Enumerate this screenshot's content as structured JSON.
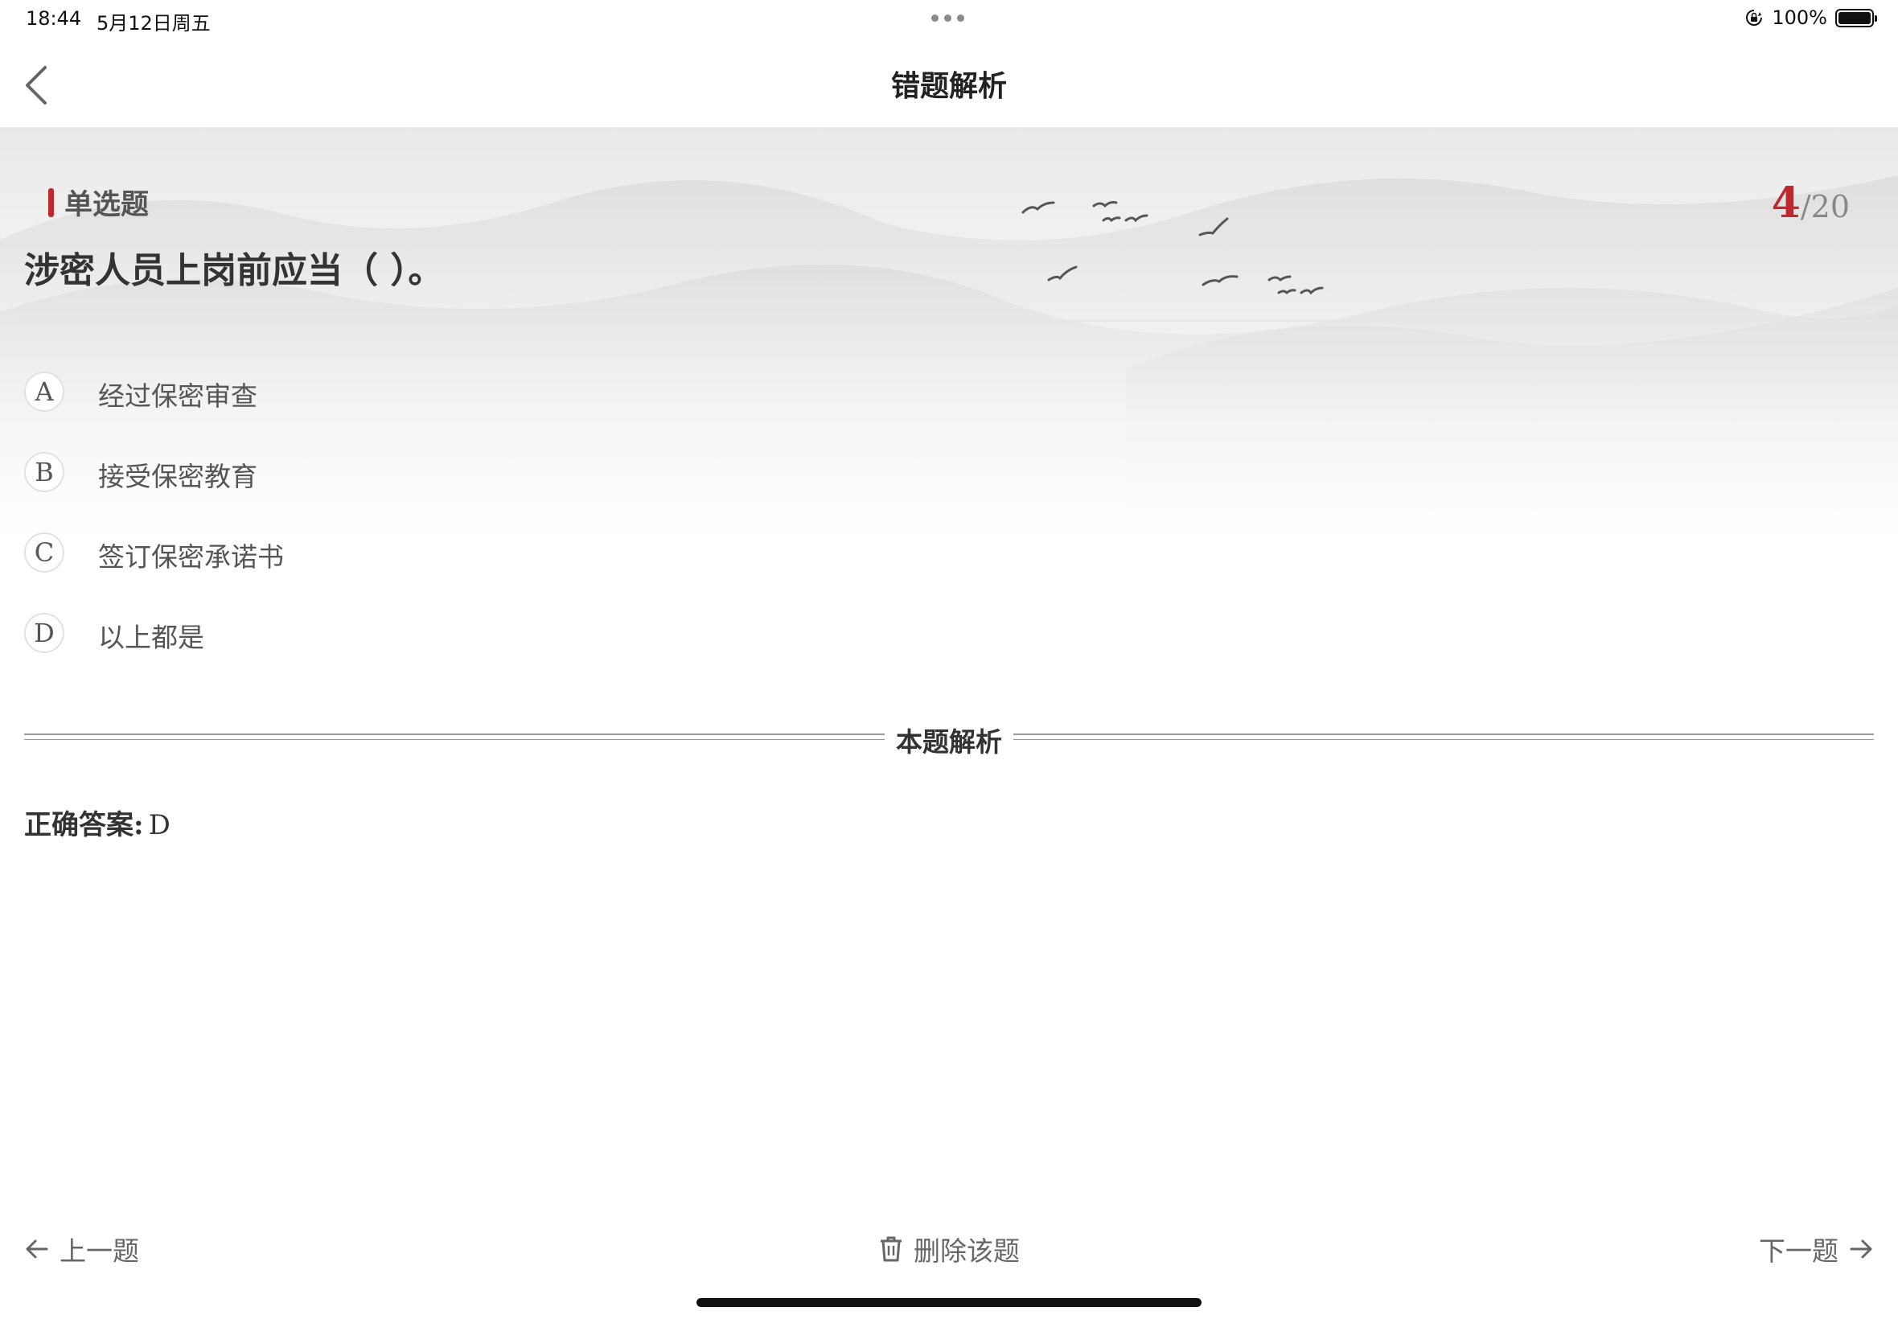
{
  "status_bar": {
    "time": "18:44",
    "date": "5月12日周五",
    "battery_text": "100%",
    "battery_level": 1.0
  },
  "nav": {
    "title": "错题解析",
    "back_icon": "chevron-left-icon"
  },
  "question": {
    "type": "单选题",
    "current": "4",
    "total": "/20",
    "text": "涉密人员上岗前应当（ ）。",
    "options": [
      {
        "letter": "A",
        "text": "经过保密审查"
      },
      {
        "letter": "B",
        "text": "接受保密教育"
      },
      {
        "letter": "C",
        "text": "签订保密承诺书"
      },
      {
        "letter": "D",
        "text": "以上都是"
      }
    ]
  },
  "analysis": {
    "section_title": "本题解析",
    "answer_label": "正确答案:",
    "answer_value": "D"
  },
  "bottom_bar": {
    "prev_label": "上一题",
    "delete_label": "删除该题",
    "next_label": "下一题"
  },
  "colors": {
    "accent": "#c0282d",
    "text": "#333333",
    "muted": "#666666"
  }
}
